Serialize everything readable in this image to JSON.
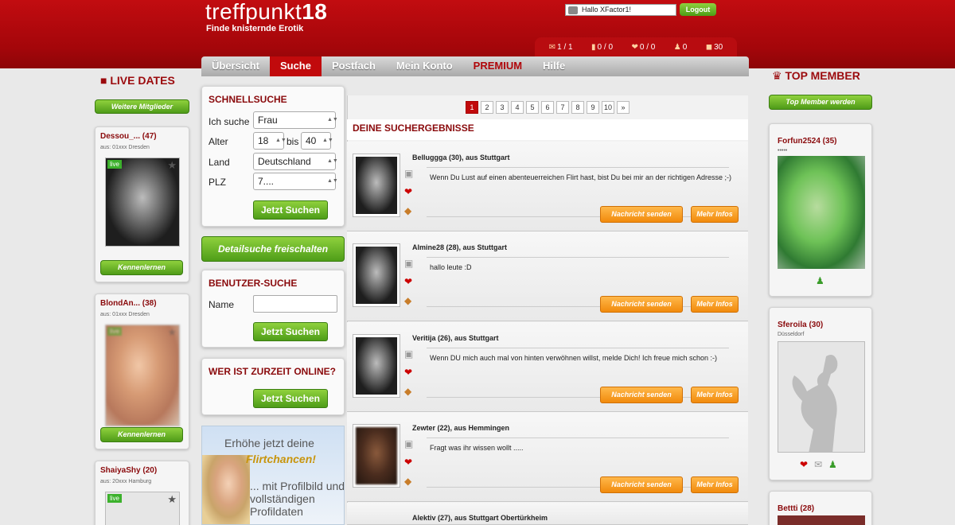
{
  "header": {
    "logo_text": "treffpunkt",
    "logo_number": "18",
    "tagline": "Finde knisternde Erotik",
    "greeting": "Hallo XFactor1!",
    "logout_label": "Logout"
  },
  "stats": {
    "mail": "1 / 1",
    "gifts": "0 / 0",
    "kisses": "0 / 0",
    "friends": "0",
    "coins": "30"
  },
  "nav": {
    "tabs": [
      "Übersicht",
      "Suche",
      "Postfach",
      "Mein Konto",
      "PREMIUM",
      "Hilfe"
    ],
    "active": "Suche"
  },
  "left": {
    "title": "LIVE DATES",
    "more_button": "Weitere Mitglieder",
    "members": [
      {
        "name": "Dessou_... (47)",
        "location": "aus: 01xxx Dresden",
        "button": "Kennenlernen",
        "live": "live"
      },
      {
        "name": "BlondAn... (38)",
        "location": "aus: 01xxx Dresden",
        "button": "Kennenlernen",
        "live": "live"
      },
      {
        "name": "ShaiyaShy (20)",
        "location": "aus: 20xxx Hamburg",
        "live": "live"
      }
    ]
  },
  "search": {
    "title": "SCHNELLSUCHE",
    "label_looking": "Ich suche",
    "value_looking": "Frau",
    "label_age": "Alter",
    "age_from": "18",
    "age_to_label": "bis",
    "age_to": "40",
    "label_country": "Land",
    "value_country": "Deutschland",
    "label_zip": "PLZ",
    "value_zip": "7....",
    "submit": "Jetzt Suchen",
    "detail_button": "Detailsuche freischalten"
  },
  "user_search": {
    "title": "BENUTZER-SUCHE",
    "label_name": "Name",
    "value_name": "",
    "submit": "Jetzt Suchen"
  },
  "online": {
    "title": "WER IST ZURZEIT ONLINE?",
    "submit": "Jetzt Suchen"
  },
  "promo": {
    "line1": "Erhöhe jetzt deine",
    "line2": "Flirtchancen!",
    "line3": "... mit Profilbild und vollständigen Profildaten"
  },
  "results": {
    "pages": [
      "1",
      "2",
      "3",
      "4",
      "5",
      "6",
      "7",
      "8",
      "9",
      "10",
      "»"
    ],
    "current_page": "1",
    "title": "DEINE SUCHERGEBNISSE",
    "message_button": "Nachricht senden",
    "info_button": "Mehr Infos",
    "items": [
      {
        "name": "Belluggga (30), aus Stuttgart",
        "message": "Wenn Du Lust auf einen abenteuerreichen Flirt hast, bist Du bei mir an der richtigen Adresse ;-)"
      },
      {
        "name": "Almine28 (28), aus Stuttgart",
        "message": "hallo leute :D"
      },
      {
        "name": "Veritija (26), aus Stuttgart",
        "message": "Wenn DU mich auch mal von hinten verwöhnen willst, melde Dich! Ich freue mich schon :-)"
      },
      {
        "name": "Zewter (22), aus Hemmingen",
        "message": "Fragt was ihr wissen wollt ....."
      },
      {
        "name": "Alektiv (27), aus Stuttgart Obertürkheim",
        "message": ""
      }
    ]
  },
  "right": {
    "title": "TOP MEMBER",
    "top_button": "Top Member werden",
    "members": [
      {
        "name": "Forfun2524 (35)",
        "location": "•••••"
      },
      {
        "name": "Sferoila (30)",
        "location": "Düsseldorf"
      },
      {
        "name": "Bettti (28)",
        "location": ""
      }
    ]
  },
  "colors": {
    "header_red": "#b1080c",
    "accent_green": "#5aa81f",
    "accent_orange": "#f39a1e"
  }
}
